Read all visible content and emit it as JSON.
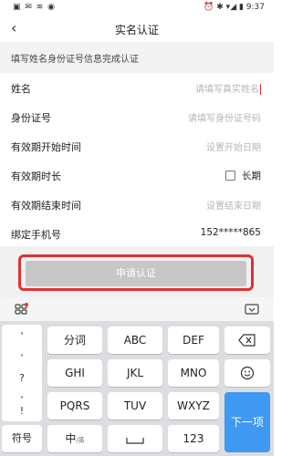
{
  "status": {
    "left": "▣ ✉ ≋ ◉",
    "right": "⏰ ✱ ▾◢ ▮ 9:37"
  },
  "nav": {
    "back": "‹",
    "title": "实名认证"
  },
  "notice": "填写姓名身份证号信息完成认证",
  "form": {
    "name_label": "姓名",
    "name_placeholder": "请填写真实姓名",
    "id_label": "身份证号",
    "id_placeholder": "请填写身份证号码",
    "start_label": "有效期开始时间",
    "start_placeholder": "设置开始日期",
    "duration_label": "有效期时长",
    "long_term": "长期",
    "end_label": "有效期结束时间",
    "end_placeholder": "设置结束日期",
    "phone_label": "绑定手机号",
    "phone_value": "152*****865"
  },
  "submit": "申请认证",
  "keyboard": {
    "symbols": [
      "'",
      "?",
      "!"
    ],
    "row1": [
      "分词",
      "ABC",
      "DEF"
    ],
    "row2": [
      "GHI",
      "JKL",
      "MNO"
    ],
    "row3": [
      "PQRS",
      "TUV",
      "WXYZ"
    ],
    "bottom": {
      "sym": "符号",
      "zh": "中",
      "zh_sub": "/英",
      "num": "123",
      "next": "下一项"
    }
  }
}
